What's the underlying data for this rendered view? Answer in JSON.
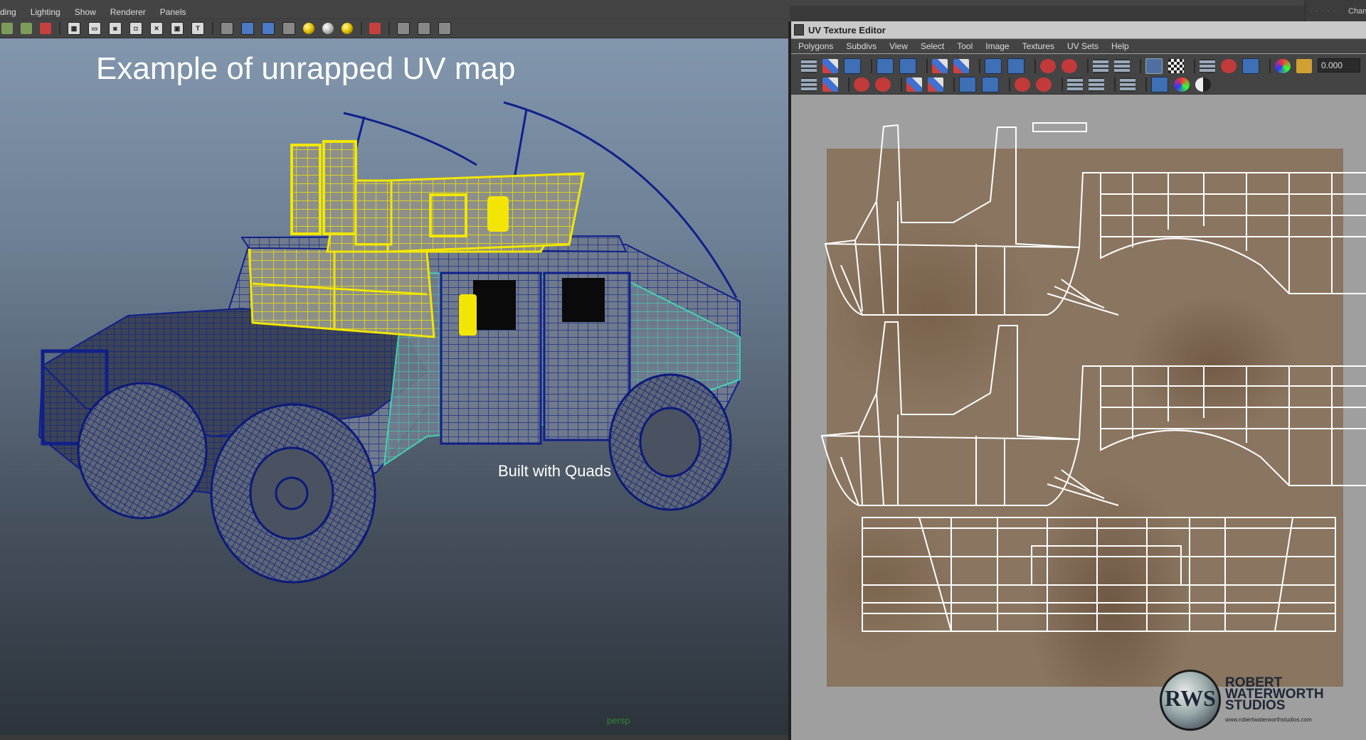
{
  "viewport": {
    "menus": [
      "ding",
      "Lighting",
      "Show",
      "Renderer",
      "Panels"
    ],
    "title": "Example of unrapped UV map",
    "caption": "Built with Quads",
    "camera": "persp"
  },
  "uv_editor": {
    "title": "UV Texture Editor",
    "menus": [
      "Polygons",
      "Subdivs",
      "View",
      "Select",
      "Tool",
      "Image",
      "Textures",
      "UV Sets",
      "Help"
    ],
    "value_field": "0.000"
  },
  "top_right": {
    "label": "Chan"
  },
  "logo": {
    "monogram": "RWS",
    "line1": "ROBERT",
    "line2": "WATERWORTH",
    "line3": "STUDIOS",
    "url": "www.robertwaterworthstudios.com"
  },
  "colors": {
    "wire_blue": "#10208a",
    "wire_yellow": "#f2e600",
    "wire_cyan": "#3fe0b8",
    "uv_shell": "#ffffff",
    "texture": "#8a7560"
  }
}
